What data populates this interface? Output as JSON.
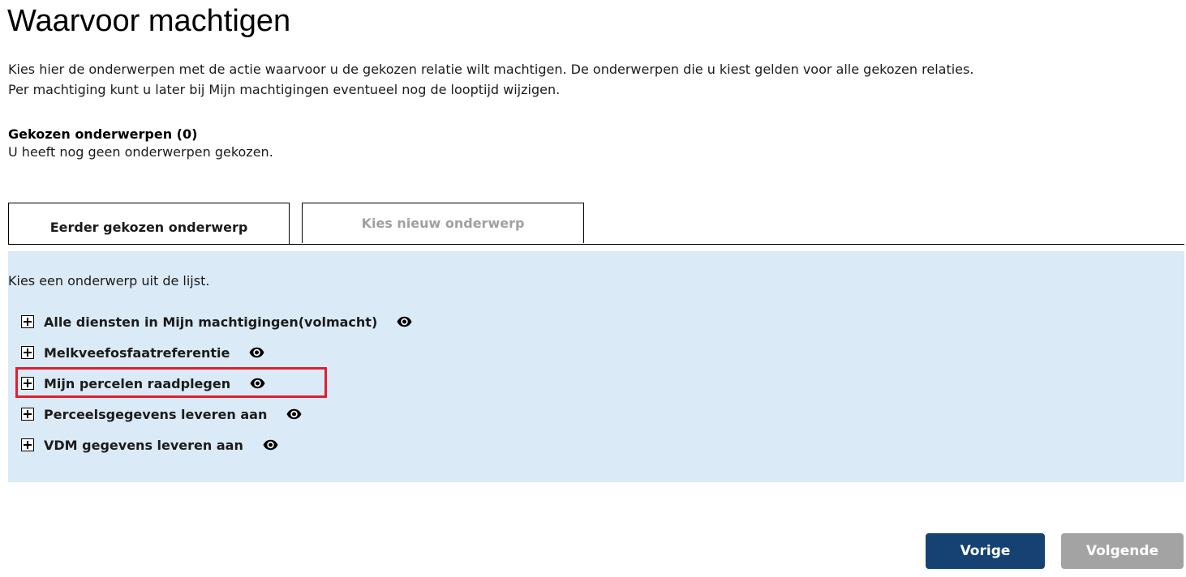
{
  "page": {
    "title": "Waarvoor machtigen",
    "intro_line1": "Kies hier de onderwerpen met de actie waarvoor u de gekozen relatie wilt machtigen. De onderwerpen die u kiest gelden voor alle gekozen relaties.",
    "intro_line2": "Per machtiging kunt u later bij Mijn machtigingen eventueel nog de looptijd wijzigen."
  },
  "chosen": {
    "title": "Gekozen onderwerpen (0)",
    "empty_text": "U heeft nog geen onderwerpen gekozen."
  },
  "tabs": [
    {
      "label": "Eerder gekozen onderwerp",
      "active": true
    },
    {
      "label": "Kies nieuw onderwerp",
      "active": false
    }
  ],
  "panel": {
    "hint": "Kies een onderwerp uit de lijst.",
    "topics": [
      {
        "label": "Alle diensten in Mijn machtigingen(volmacht)",
        "icon": "eye-icon",
        "highlighted": false
      },
      {
        "label": "Melkveefosfaatreferentie",
        "icon": "eye-icon",
        "highlighted": false
      },
      {
        "label": "Mijn percelen raadplegen",
        "icon": "eye-icon",
        "highlighted": true
      },
      {
        "label": "Perceelsgegevens leveren aan",
        "icon": "eye-icon",
        "highlighted": false
      },
      {
        "label": "VDM gegevens leveren aan",
        "icon": "eye-icon",
        "highlighted": false
      }
    ]
  },
  "buttons": {
    "previous": "Vorige",
    "next": "Volgende"
  },
  "colors": {
    "panel_background": "#daeaf6",
    "primary_button": "#154273",
    "disabled_button": "#a3a3a3",
    "highlight_border": "#e0202e"
  }
}
